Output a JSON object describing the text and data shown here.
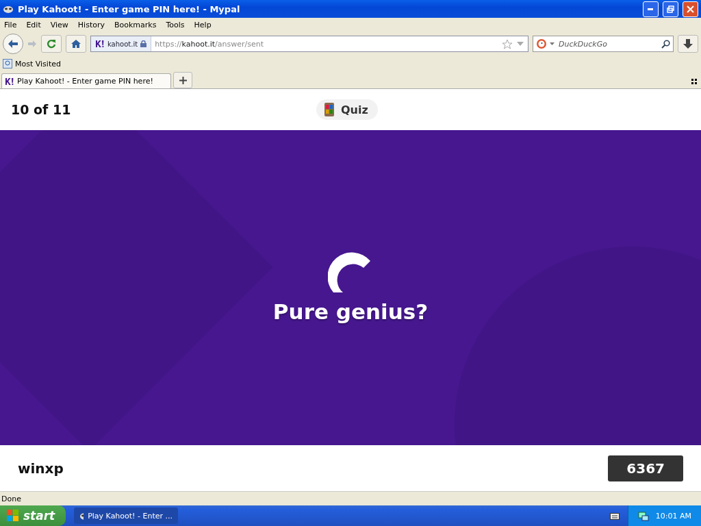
{
  "window": {
    "title": "Play Kahoot! - Enter game PIN here! - Mypal"
  },
  "menu": [
    "File",
    "Edit",
    "View",
    "History",
    "Bookmarks",
    "Tools",
    "Help"
  ],
  "navbar": {
    "site_label": "kahoot.it",
    "url": {
      "scheme": "https://",
      "host": "kahoot.it",
      "path": "/answer/sent"
    },
    "search": {
      "placeholder": "DuckDuckGo"
    }
  },
  "bookmarks": [
    "Most Visited"
  ],
  "tabs": [
    {
      "label": "Play Kahoot! - Enter game PIN here!",
      "selected": true
    }
  ],
  "page": {
    "progress": "10 of 11",
    "mode": "Quiz",
    "message": "Pure genius?",
    "player": "winxp",
    "score": "6367"
  },
  "status_bar": "Done",
  "taskbar": {
    "start": "start",
    "tasks": [
      {
        "label": "Play Kahoot! - Enter ...",
        "selected": true
      }
    ],
    "clock": "10:01 AM"
  }
}
